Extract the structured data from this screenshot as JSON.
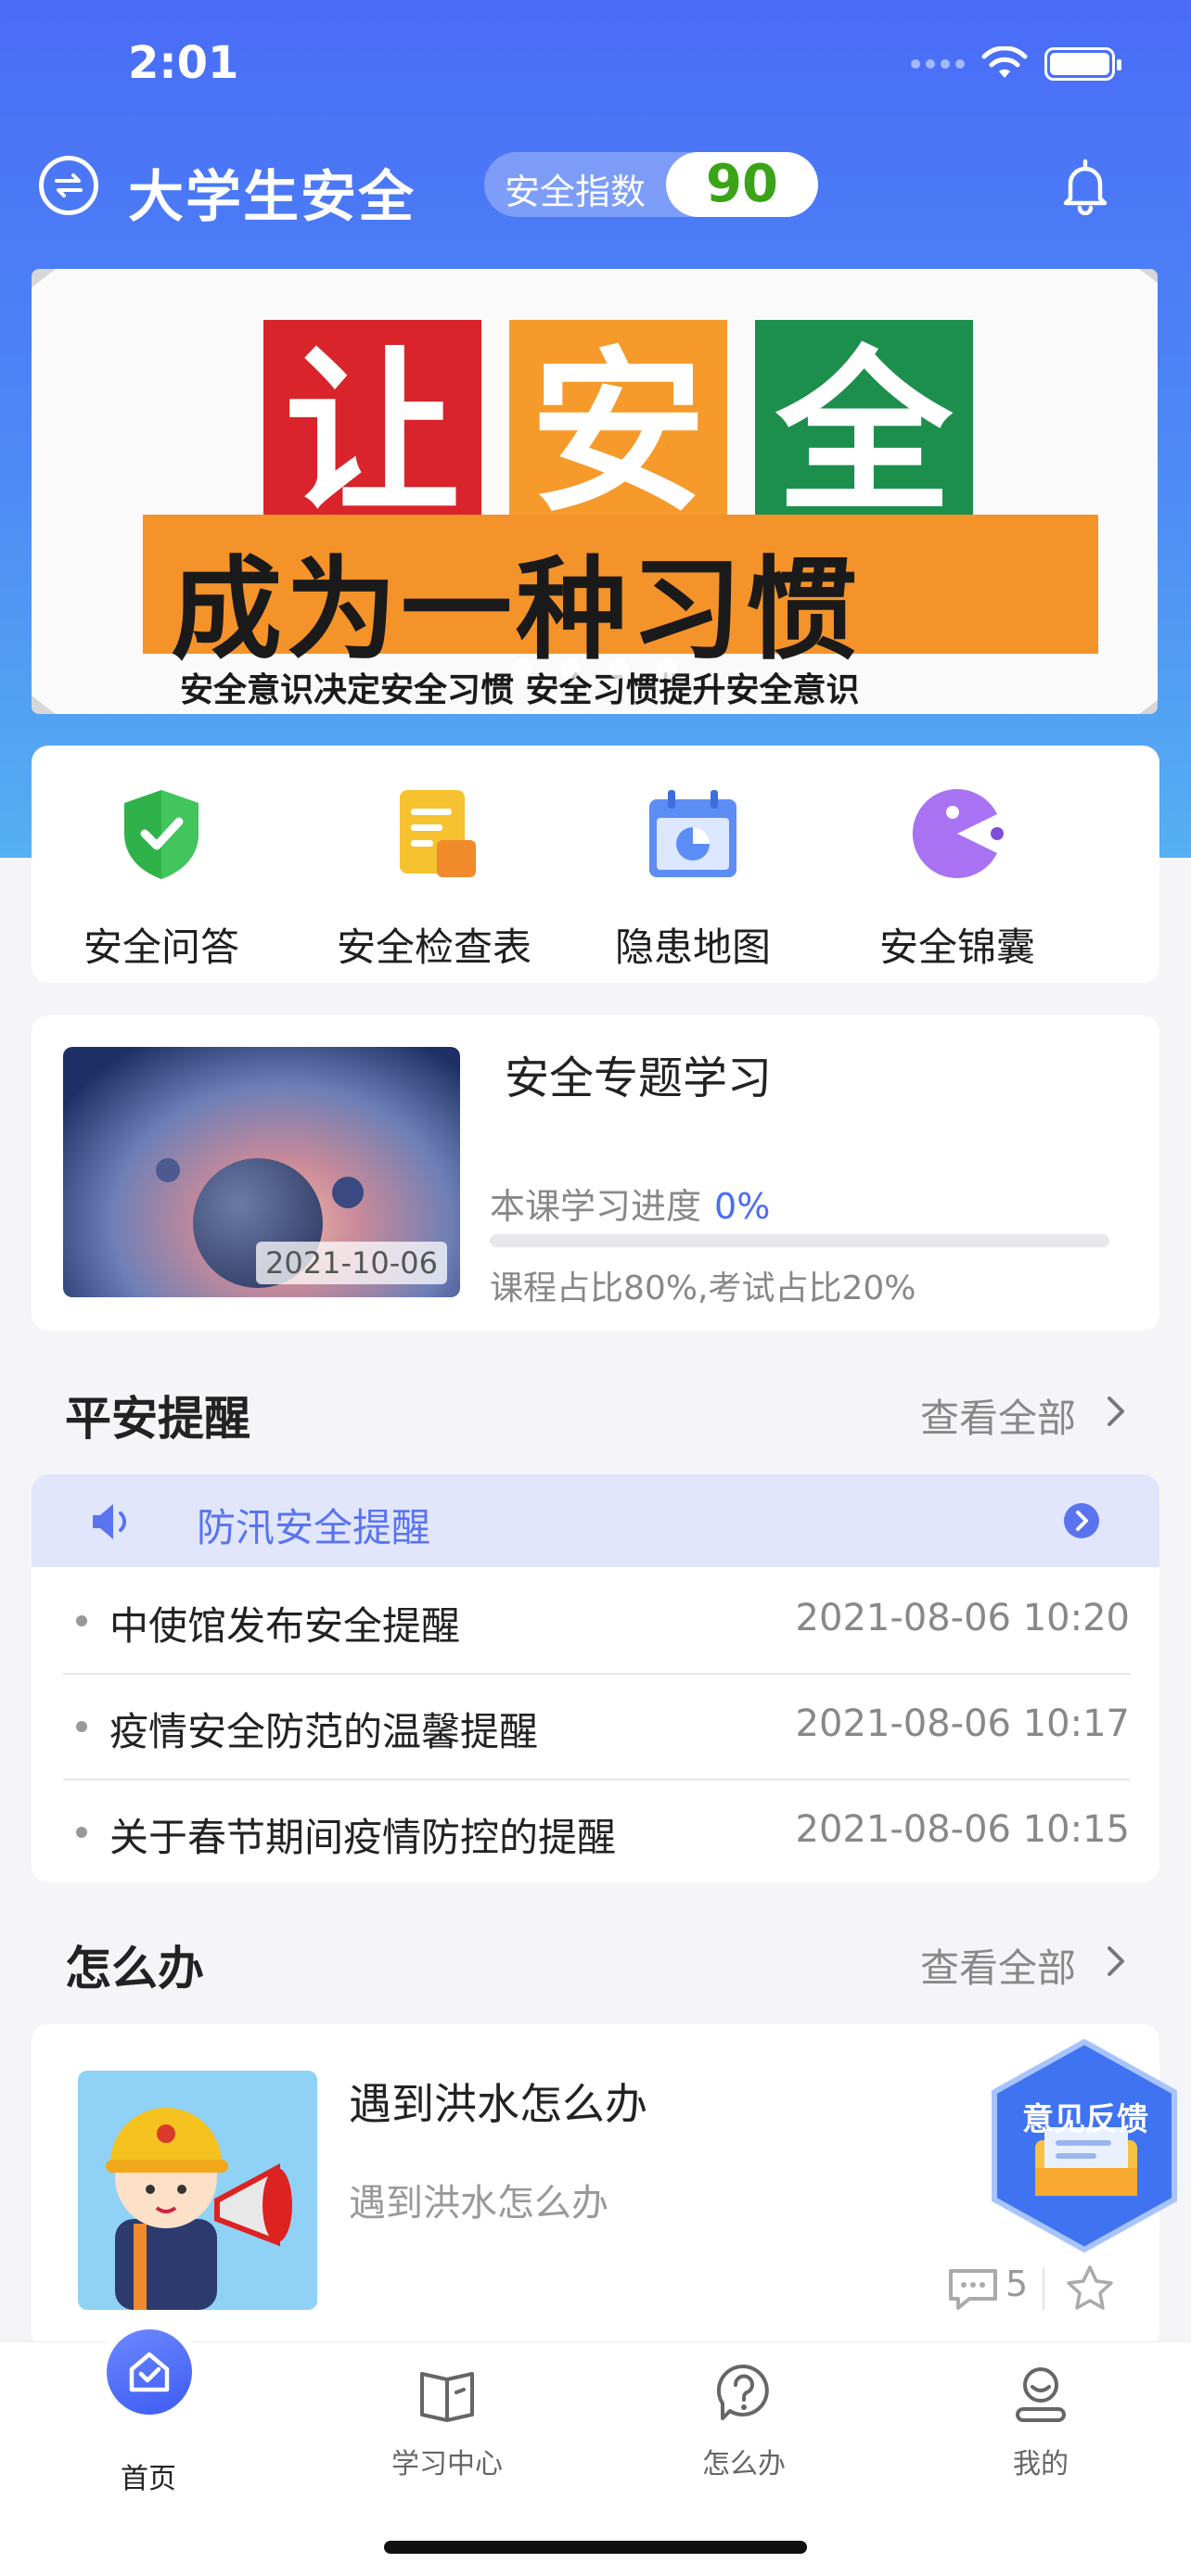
{
  "status_bar": {
    "time": "2:01"
  },
  "header": {
    "title": "大学生安全",
    "index_label": "安全指数",
    "index_value": "90"
  },
  "banner": {
    "words": [
      "让",
      "安",
      "全"
    ],
    "subtitle": "成为一种习惯",
    "caption": "安全意识决定安全习惯  安全习惯提升安全意识",
    "dot_count": 4
  },
  "quick_actions": [
    {
      "label": "安全问答",
      "icon": "shield-check-icon"
    },
    {
      "label": "安全检查表",
      "icon": "checklist-icon"
    },
    {
      "label": "隐患地图",
      "icon": "calendar-chart-icon"
    },
    {
      "label": "安全锦囊",
      "icon": "pacman-icon"
    }
  ],
  "course": {
    "title": "安全专题学习",
    "date": "2021-10-06",
    "progress_label": "本课学习进度",
    "progress_value": "0%",
    "progress_fraction": 0,
    "note": "课程占比80%,考试占比20%"
  },
  "reminders": {
    "title": "平安提醒",
    "more": "查看全部",
    "banner_text": "防汛安全提醒",
    "items": [
      {
        "text": "中使馆发布安全提醒",
        "time": "2021-08-06 10:20"
      },
      {
        "text": "疫情安全防范的温馨提醒",
        "time": "2021-08-06 10:17"
      },
      {
        "text": "关于春节期间疫情防控的提醒",
        "time": "2021-08-06 10:15"
      }
    ]
  },
  "howto": {
    "title": "怎么办",
    "more": "查看全部",
    "item": {
      "title": "遇到洪水怎么办",
      "desc": "遇到洪水怎么办",
      "comments": "5"
    }
  },
  "feedback": {
    "label": "意见反馈"
  },
  "tabs": [
    {
      "label": "首页",
      "icon": "home-icon",
      "active": true
    },
    {
      "label": "学习中心",
      "icon": "book-icon",
      "active": false
    },
    {
      "label": "怎么办",
      "icon": "question-icon",
      "active": false
    },
    {
      "label": "我的",
      "icon": "profile-icon",
      "active": false
    }
  ],
  "colors": {
    "primary": "#4a6cf7",
    "index_green": "#3aa416",
    "reminder_banner": "#e1e6fd"
  }
}
